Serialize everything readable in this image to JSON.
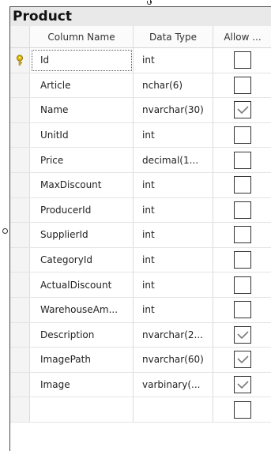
{
  "table": {
    "title": "Product",
    "headers": {
      "column_name": "Column Name",
      "data_type": "Data Type",
      "allow_nulls": "Allow ..."
    },
    "rows": [
      {
        "name": "Id",
        "type": "int",
        "allow_nulls": false,
        "primary_key": true
      },
      {
        "name": "Article",
        "type": "nchar(6)",
        "allow_nulls": false
      },
      {
        "name": "Name",
        "type": "nvarchar(30)",
        "allow_nulls": true
      },
      {
        "name": "UnitId",
        "type": "int",
        "allow_nulls": false
      },
      {
        "name": "Price",
        "type": "decimal(1...",
        "allow_nulls": false
      },
      {
        "name": "MaxDiscount",
        "type": "int",
        "allow_nulls": false
      },
      {
        "name": "ProducerId",
        "type": "int",
        "allow_nulls": false
      },
      {
        "name": "SupplierId",
        "type": "int",
        "allow_nulls": false
      },
      {
        "name": "CategoryId",
        "type": "int",
        "allow_nulls": false
      },
      {
        "name": "ActualDiscount",
        "type": "int",
        "allow_nulls": false
      },
      {
        "name": "WarehouseAm...",
        "type": "int",
        "allow_nulls": false
      },
      {
        "name": "Description",
        "type": "nvarchar(2...",
        "allow_nulls": true
      },
      {
        "name": "ImagePath",
        "type": "nvarchar(60)",
        "allow_nulls": true
      },
      {
        "name": "Image",
        "type": "varbinary(...",
        "allow_nulls": true
      },
      {
        "name": "",
        "type": "",
        "allow_nulls": false
      }
    ]
  },
  "icons": {
    "primary_key": "key-icon",
    "checked": "checkmark-icon"
  },
  "colors": {
    "key_icon": "#d8b400",
    "checkmark": "#7a7a7a",
    "border": "#4a4a4a"
  }
}
